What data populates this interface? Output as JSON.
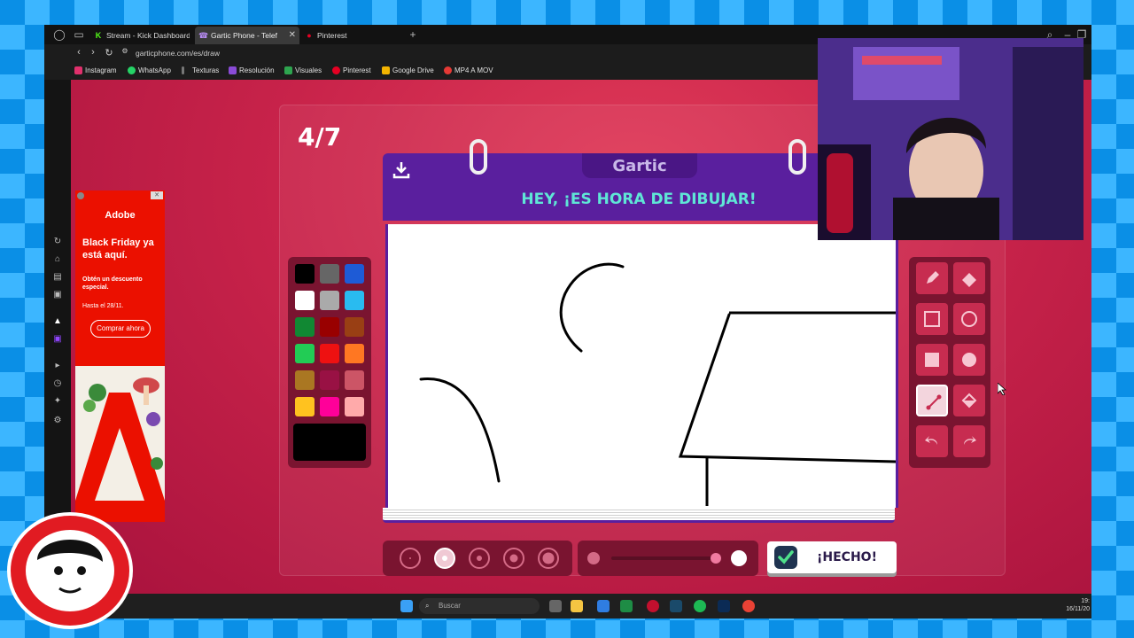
{
  "browser": {
    "tabs": [
      {
        "label": "Stream - Kick Dashboard",
        "active": false
      },
      {
        "label": "Gartic Phone - Telef",
        "active": true
      },
      {
        "label": "Pinterest",
        "active": false
      }
    ],
    "url": "garticphone.com/es/draw",
    "new_tab": "+",
    "bookmarks": [
      {
        "label": "Instagram",
        "color": "#e1306c"
      },
      {
        "label": "WhatsApp",
        "color": "#25d366"
      },
      {
        "label": "Texturas",
        "color": "#dddddd"
      },
      {
        "label": "Resolución",
        "color": "#8a4bd6"
      },
      {
        "label": "Visuales",
        "color": "#2ea44f"
      },
      {
        "label": "Pinterest",
        "color": "#e60023"
      },
      {
        "label": "Google Drive",
        "color": "#f4b400"
      },
      {
        "label": "MP4 A MOV",
        "color": "#e53935"
      }
    ]
  },
  "ad": {
    "brand": "Adobe",
    "headline": "Black Friday ya está aquí.",
    "sub": "Obtén un descuento especial.",
    "date": "Hasta el 28/11.",
    "button": "Comprar ahora",
    "badge": "A"
  },
  "game": {
    "round": "4/7",
    "logo": "Gartic",
    "title": "HEY, ¡ES HORA DE DIBUJAR!",
    "done_button": "¡HECHO!",
    "palette": [
      "#000000",
      "#666666",
      "#1e5bd6",
      "#ffffff",
      "#aaaaaa",
      "#29bbf0",
      "#118833",
      "#990000",
      "#993f14",
      "#22cc55",
      "#ee1111",
      "#ff7722",
      "#aa7722",
      "#991144",
      "#cc5566",
      "#ffc21f",
      "#ff0099",
      "#ffaaaa"
    ],
    "current_color": "#000000",
    "brush_sizes": 5,
    "selected_brush": 2,
    "selected_tool": "line",
    "opacity_percent": 100
  },
  "taskbar": {
    "search_placeholder": "Buscar",
    "time": "19:",
    "date": "16/11/20"
  },
  "colors": {
    "accent_purple": "#5a1f9e",
    "title_teal": "#5fe6d6",
    "page_red": "#c8234a"
  }
}
